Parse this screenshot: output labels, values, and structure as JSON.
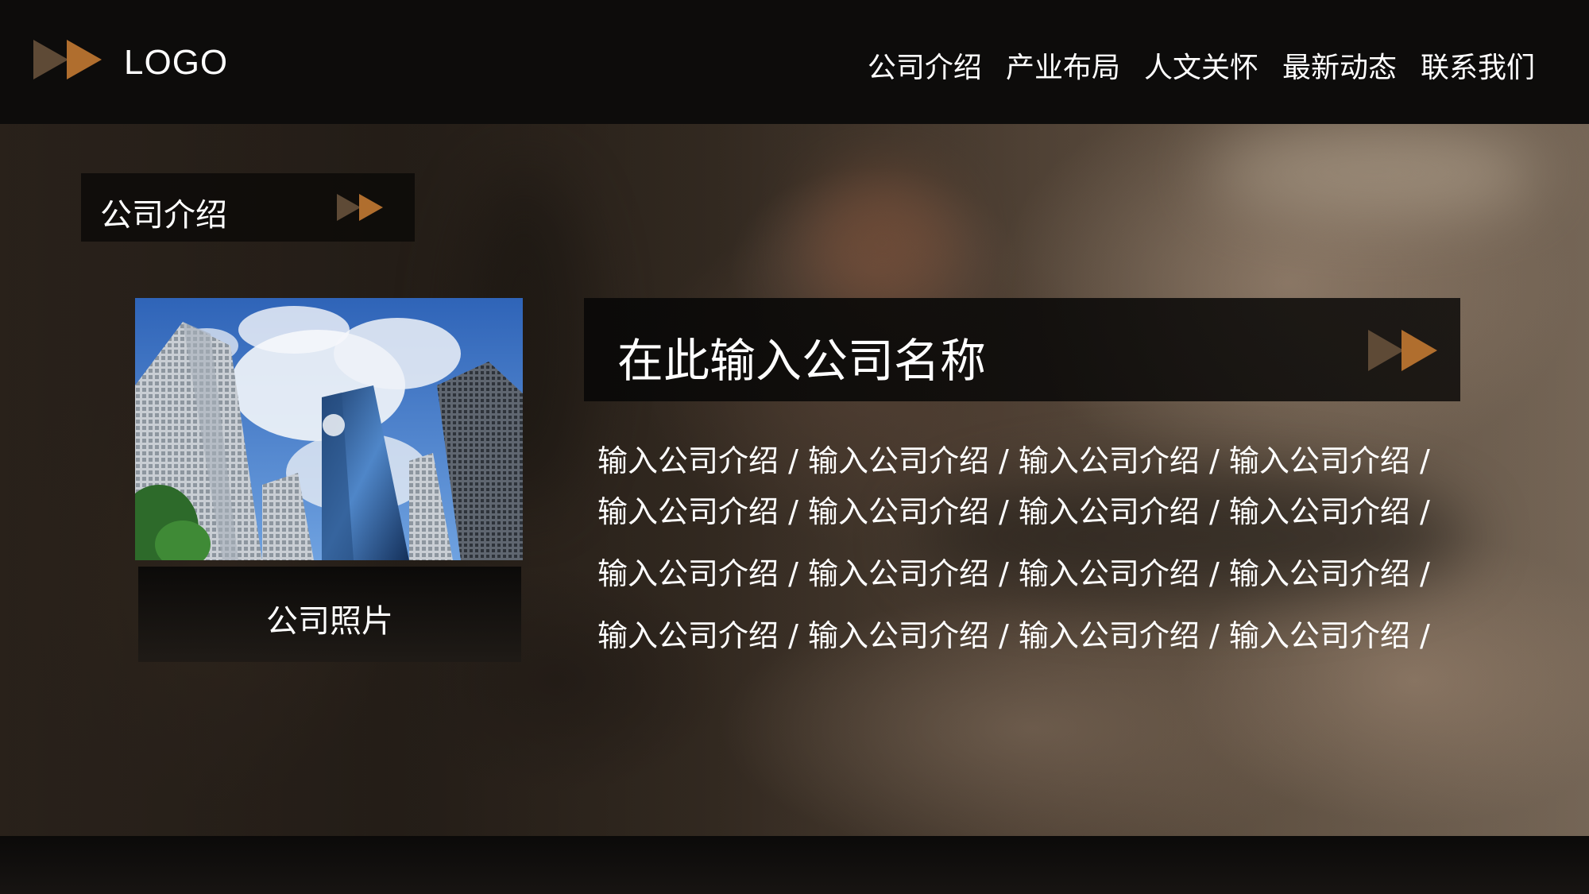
{
  "header": {
    "logo_text": "LOGO",
    "nav": [
      {
        "label": "公司介绍"
      },
      {
        "label": "产业布局"
      },
      {
        "label": "人文关怀"
      },
      {
        "label": "最新动态"
      },
      {
        "label": "联系我们"
      }
    ]
  },
  "section": {
    "title": "公司介绍"
  },
  "photo": {
    "caption": "公司照片"
  },
  "company": {
    "name": "在此输入公司名称",
    "paragraphs": [
      "输入公司介绍 / 输入公司介绍 / 输入公司介绍 / 输入公司介绍 / 输入公司介绍 / 输入公司介绍 / 输入公司介绍 / 输入公司介绍 /",
      "输入公司介绍 / 输入公司介绍 / 输入公司介绍 / 输入公司介绍 /",
      "输入公司介绍 / 输入公司介绍 / 输入公司介绍 / 输入公司介绍 /"
    ]
  },
  "colors": {
    "accent": "#b06e2e",
    "accent_dark": "#5e4a36",
    "header_bg": "#0d0c0b"
  },
  "icons": {
    "arrow": "double-play-arrow-icon"
  }
}
